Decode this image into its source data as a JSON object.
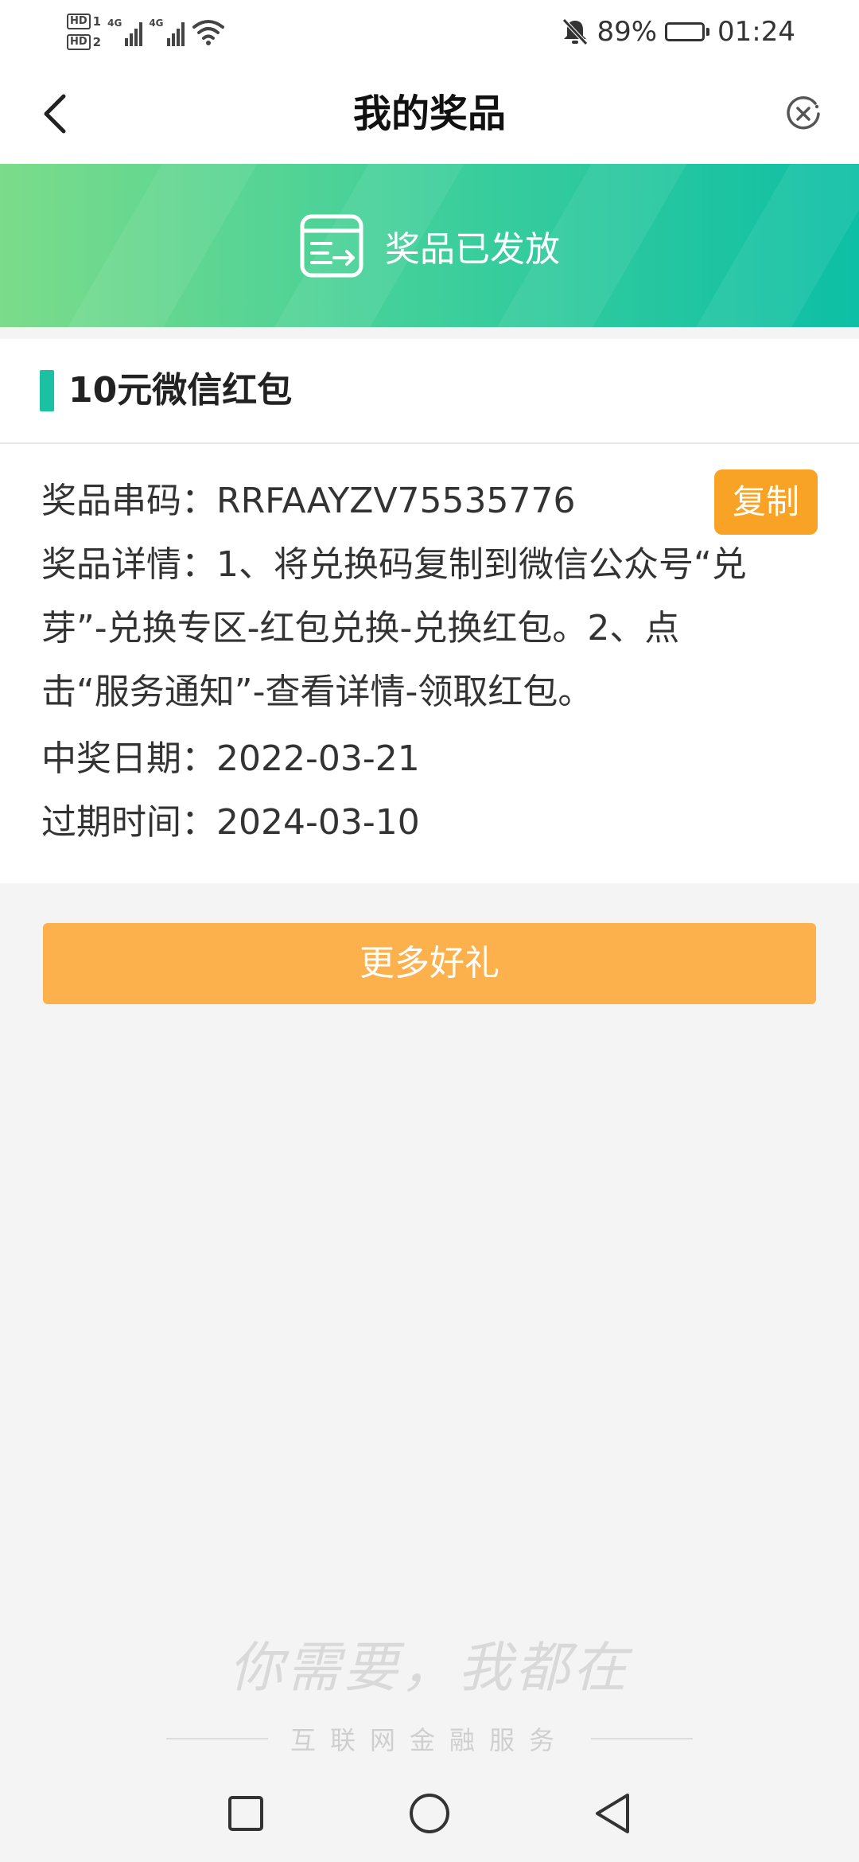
{
  "status_bar": {
    "sim1": "HD",
    "sim1_index": "1",
    "sim2": "HD",
    "sim2_index": "2",
    "network1": "4G",
    "network2": "4G",
    "battery_percent": "89%",
    "battery_level": 0.89,
    "time": "01:24",
    "icons": [
      "signal-icon",
      "wifi-icon",
      "mute-bell-icon",
      "battery-icon"
    ]
  },
  "nav": {
    "title": "我的奖品",
    "back_icon": "back-arrow-icon",
    "close_icon": "close-circle-icon"
  },
  "banner": {
    "text": "奖品已发放",
    "icon": "prize-delivered-icon",
    "gradient": [
      "#7bdc8a",
      "#0dbfa5"
    ]
  },
  "prize": {
    "name": "10元微信红包",
    "code_label": "奖品串码：",
    "code": "RRFAAYZV75535776",
    "copy_label": "复制",
    "detail_label": "奖品详情：",
    "detail_text_1": "1、将兑换码复制到微信公众号“兑",
    "detail_text_2": "芽”-兑换专区-红包兑换-兑换红包。2、点",
    "detail_text_3": "击“服务通知”-查看详情-领取红包。",
    "win_date_label": "中奖日期：",
    "win_date": "2022-03-21",
    "expire_label": "过期时间：",
    "expire_date": "2024-03-10"
  },
  "actions": {
    "more_gifts": "更多好礼"
  },
  "watermark": {
    "slogan": "你需要，我都在",
    "text": "互联网金融服务"
  },
  "colors": {
    "accent": "#1cc0a3",
    "copy_button": "#f8a326",
    "more_button": "#fdb14d"
  }
}
